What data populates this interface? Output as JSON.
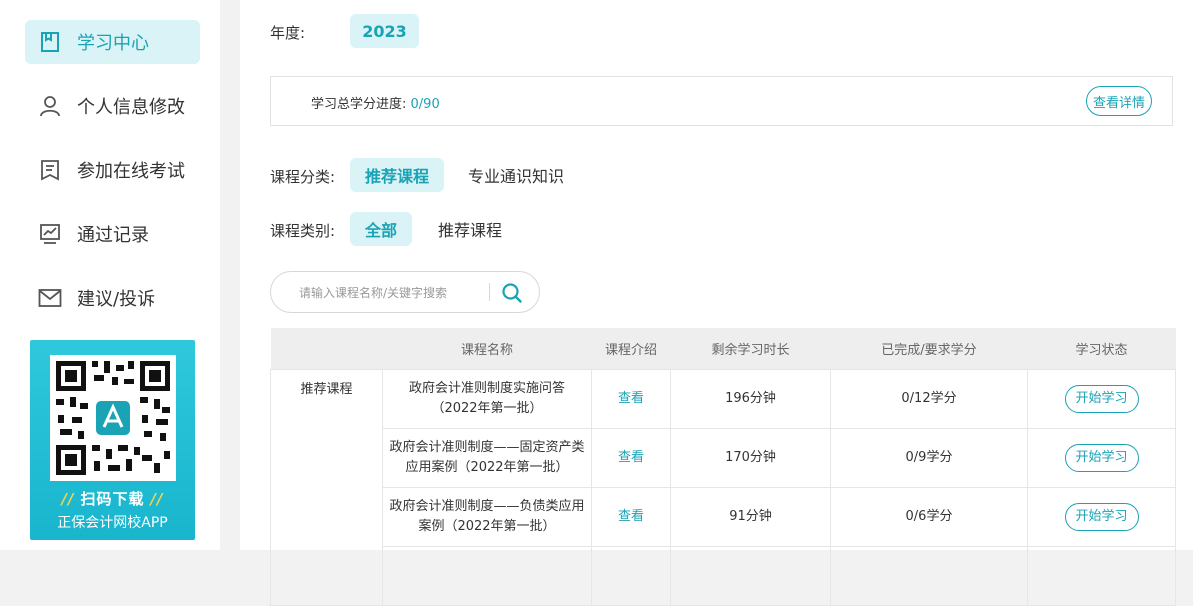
{
  "sidebar": {
    "items": [
      {
        "label": "学习中心",
        "icon": "bookmark-icon"
      },
      {
        "label": "个人信息修改",
        "icon": "user-icon"
      },
      {
        "label": "参加在线考试",
        "icon": "document-icon"
      },
      {
        "label": "通过记录",
        "icon": "chart-icon"
      },
      {
        "label": "建议/投诉",
        "icon": "mail-icon"
      }
    ],
    "qr": {
      "download_label": "扫码下载",
      "app_label": "正保会计网校APP"
    }
  },
  "main": {
    "year_label": "年度:",
    "year_value": "2023",
    "progress": {
      "label": "学习总学分进度:",
      "value": "0/90",
      "detail_button": "查看详情"
    },
    "category": {
      "label": "课程分类:",
      "options": [
        "推荐课程",
        "专业通识知识"
      ],
      "selected": "推荐课程"
    },
    "type": {
      "label": "课程类别:",
      "options": [
        "全部",
        "推荐课程"
      ],
      "selected": "全部"
    },
    "search": {
      "placeholder": "请输入课程名称/关键字搜索"
    },
    "table": {
      "headers": [
        "",
        "课程名称",
        "课程介绍",
        "剩余学习时长",
        "已完成/要求学分",
        "学习状态"
      ],
      "group_label": "推荐课程",
      "rows": [
        {
          "name": "政府会计准则制度实施问答（2022年第一批）",
          "intro": "查看",
          "remaining": "196分钟",
          "credits": "0/12学分",
          "status": "开始学习"
        },
        {
          "name": "政府会计准则制度——固定资产类应用案例（2022年第一批）",
          "intro": "查看",
          "remaining": "170分钟",
          "credits": "0/9学分",
          "status": "开始学习"
        },
        {
          "name": "政府会计准则制度——负债类应用案例（2022年第一批）",
          "intro": "查看",
          "remaining": "91分钟",
          "credits": "0/6学分",
          "status": "开始学习"
        }
      ]
    }
  },
  "colors": {
    "accent": "#1aa3b5",
    "accent_bg": "#d9f3f6",
    "qr_card": "#18b5cd"
  }
}
